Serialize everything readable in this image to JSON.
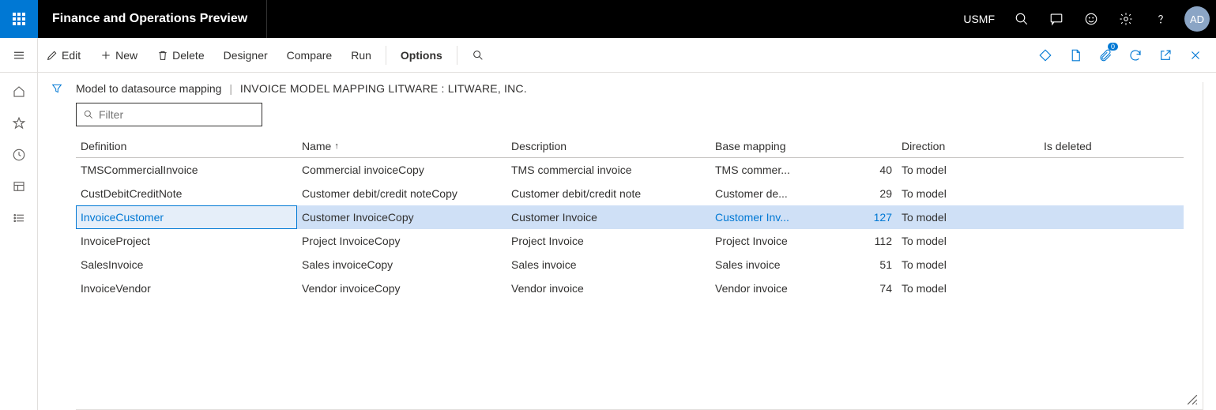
{
  "topbar": {
    "app_title": "Finance and Operations Preview",
    "company": "USMF",
    "avatar_initials": "AD"
  },
  "cmdbar": {
    "edit": "Edit",
    "new": "New",
    "delete": "Delete",
    "designer": "Designer",
    "compare": "Compare",
    "run": "Run",
    "options": "Options",
    "attachment_count": "0"
  },
  "breadcrumb": {
    "part1": "Model to datasource mapping",
    "part2": "INVOICE MODEL MAPPING LITWARE : LITWARE, INC."
  },
  "filter": {
    "placeholder": "Filter"
  },
  "grid": {
    "headers": {
      "definition": "Definition",
      "name": "Name",
      "description": "Description",
      "base_mapping": "Base mapping",
      "direction": "Direction",
      "is_deleted": "Is deleted"
    },
    "rows": [
      {
        "definition": "TMSCommercialInvoice",
        "name": "Commercial invoiceCopy",
        "description": "TMS commercial invoice",
        "base_mapping": "TMS commer...",
        "count": "40",
        "direction": "To model",
        "is_deleted": "",
        "selected": false
      },
      {
        "definition": "CustDebitCreditNote",
        "name": "Customer debit/credit noteCopy",
        "description": "Customer debit/credit note",
        "base_mapping": "Customer de...",
        "count": "29",
        "direction": "To model",
        "is_deleted": "",
        "selected": false
      },
      {
        "definition": "InvoiceCustomer",
        "name": "Customer InvoiceCopy",
        "description": "Customer Invoice",
        "base_mapping": "Customer Inv...",
        "count": "127",
        "direction": "To model",
        "is_deleted": "",
        "selected": true
      },
      {
        "definition": "InvoiceProject",
        "name": "Project InvoiceCopy",
        "description": "Project Invoice",
        "base_mapping": "Project Invoice",
        "count": "112",
        "direction": "To model",
        "is_deleted": "",
        "selected": false
      },
      {
        "definition": "SalesInvoice",
        "name": "Sales invoiceCopy",
        "description": "Sales invoice",
        "base_mapping": "Sales invoice",
        "count": "51",
        "direction": "To model",
        "is_deleted": "",
        "selected": false
      },
      {
        "definition": "InvoiceVendor",
        "name": "Vendor invoiceCopy",
        "description": "Vendor invoice",
        "base_mapping": "Vendor invoice",
        "count": "74",
        "direction": "To model",
        "is_deleted": "",
        "selected": false
      }
    ]
  }
}
